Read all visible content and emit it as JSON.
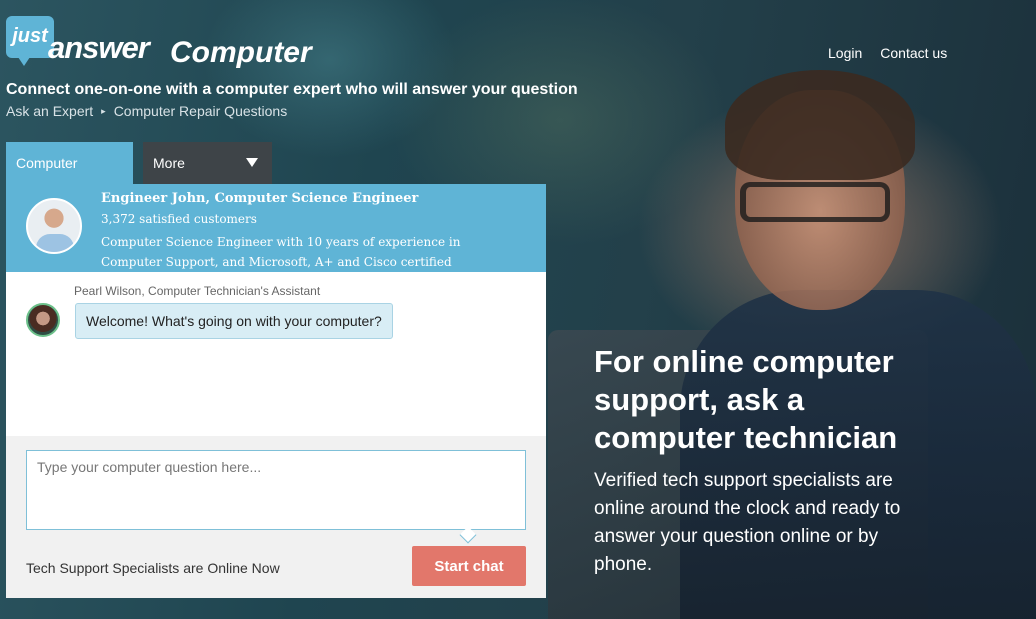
{
  "header": {
    "logo_bubble": "just",
    "logo_word": "answer",
    "product": "Computer",
    "tagline": "Connect one-on-one with a computer expert who will answer your question",
    "nav": [
      {
        "label": "Login"
      },
      {
        "label": "Contact us"
      }
    ]
  },
  "breadcrumb": {
    "items": [
      "Ask an Expert",
      "Computer Repair Questions"
    ],
    "separator": "▸"
  },
  "tabs": {
    "active": "Computer",
    "more": "More"
  },
  "expert": {
    "name": "Engineer John, Computer Science Engineer",
    "customers": "3,372 satisfied customers",
    "description": "Computer Science Engineer with 10 years of experience in Computer Support, and Microsoft, A+ and Cisco certified"
  },
  "assistant": {
    "name": "Pearl Wilson, Computer Technician's Assistant",
    "message": "Welcome! What's going on with your computer?"
  },
  "compose": {
    "placeholder": "Type your computer question here...",
    "status": "Tech Support Specialists are Online Now",
    "button": "Start chat"
  },
  "hero": {
    "title": "For online computer support, ask a computer technician",
    "subtitle": "Verified tech support specialists are online around the clock and ready to answer your question online or by phone."
  },
  "colors": {
    "accent": "#5fb4d6",
    "button": "#e2776b",
    "tab_inactive": "#3e4448"
  }
}
